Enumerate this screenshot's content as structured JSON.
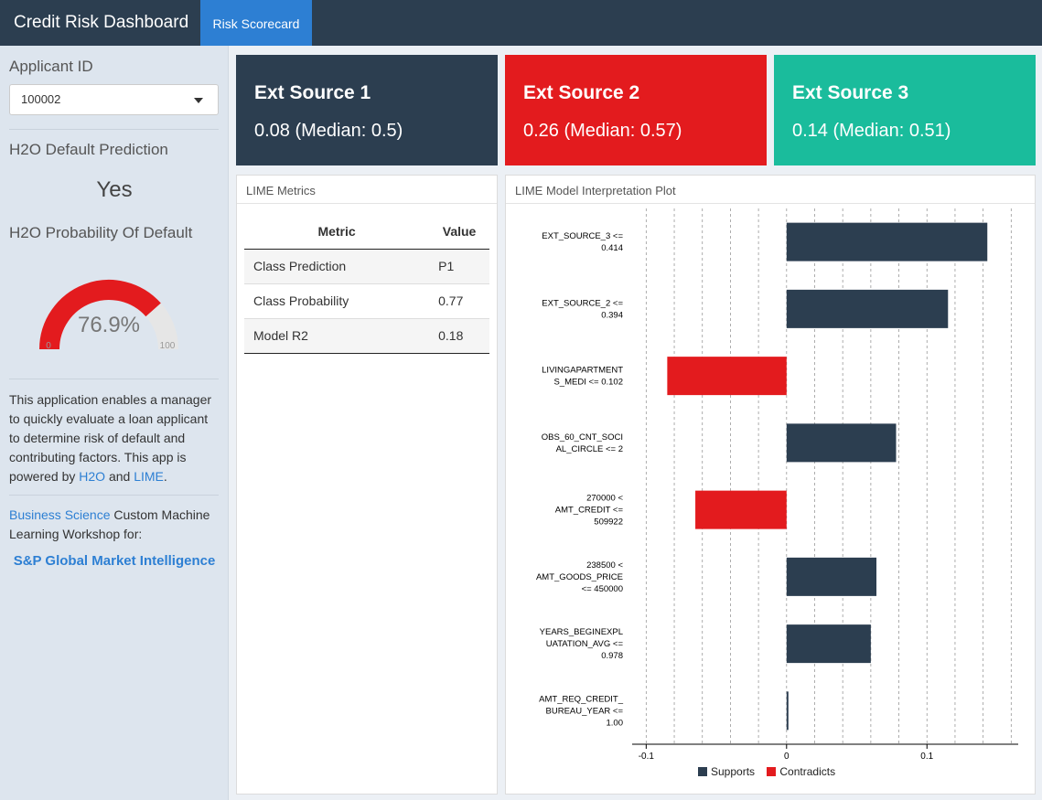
{
  "header": {
    "title": "Credit Risk Dashboard",
    "tab": "Risk Scorecard"
  },
  "sidebar": {
    "applicant_label": "Applicant ID",
    "applicant_value": "100002",
    "prediction_label": "H2O Default Prediction",
    "prediction_value": "Yes",
    "probability_label": "H2O Probability Of Default",
    "gauge": {
      "value": 76.9,
      "display": "76.9%",
      "min_label": "0",
      "max_label": "100",
      "fill_color": "#e31b1e",
      "track_color": "#e6e6e6"
    },
    "description": {
      "text": "This application enables a manager to quickly evaluate a loan applicant to determine risk of default and contributing factors. This app is powered by ",
      "link1": "H2O",
      "and": " and ",
      "link2": "LIME",
      "end": "."
    },
    "workshop": {
      "link": "Business Science",
      "text": " Custom Machine Learning Workshop for:"
    },
    "org": "S&P Global Market Intelligence"
  },
  "value_boxes": [
    {
      "title": "Ext Source 1",
      "value": "0.08 (Median: 0.5)",
      "color": "#2c3e50"
    },
    {
      "title": "Ext Source 2",
      "value": "0.26 (Median: 0.57)",
      "color": "#e31b1e"
    },
    {
      "title": "Ext Source 3",
      "value": "0.14 (Median: 0.51)",
      "color": "#1abc9c"
    }
  ],
  "lime_metrics": {
    "title": "LIME Metrics",
    "columns": [
      "Metric",
      "Value"
    ],
    "rows": [
      [
        "Class Prediction",
        "P1"
      ],
      [
        "Class Probability",
        "0.77"
      ],
      [
        "Model R2",
        "0.18"
      ]
    ]
  },
  "plot_panel_title": "LIME Model Interpretation Plot",
  "chart_data": {
    "type": "bar",
    "orientation": "horizontal",
    "categories": [
      [
        "EXT_SOURCE_3 <=",
        "0.414"
      ],
      [
        "EXT_SOURCE_2 <=",
        "0.394"
      ],
      [
        "LIVINGAPARTMENT",
        "S_MEDI <= 0.102"
      ],
      [
        "OBS_60_CNT_SOCI",
        "AL_CIRCLE <= 2"
      ],
      [
        "270000 <",
        "AMT_CREDIT <=",
        "509922"
      ],
      [
        "238500 <",
        "AMT_GOODS_PRICE",
        "<= 450000"
      ],
      [
        "YEARS_BEGINEXPL",
        "UATATION_AVG <=",
        "0.978"
      ],
      [
        "AMT_REQ_CREDIT_",
        "BUREAU_YEAR <=",
        "1.00"
      ]
    ],
    "values": [
      0.143,
      0.115,
      -0.085,
      0.078,
      -0.065,
      0.064,
      0.06,
      0.001
    ],
    "labels": [
      "Supports",
      "Supports",
      "Contradicts",
      "Supports",
      "Contradicts",
      "Supports",
      "Supports",
      "Supports"
    ],
    "legend": [
      {
        "name": "Supports",
        "color": "#2c3e50"
      },
      {
        "name": "Contradicts",
        "color": "#e31b1e"
      }
    ],
    "xlim": [
      -0.11,
      0.165
    ],
    "xticks": [
      -0.1,
      0,
      0.1
    ],
    "xtick_labels": [
      "-0.1",
      "0",
      "0.1"
    ],
    "grid": true
  }
}
